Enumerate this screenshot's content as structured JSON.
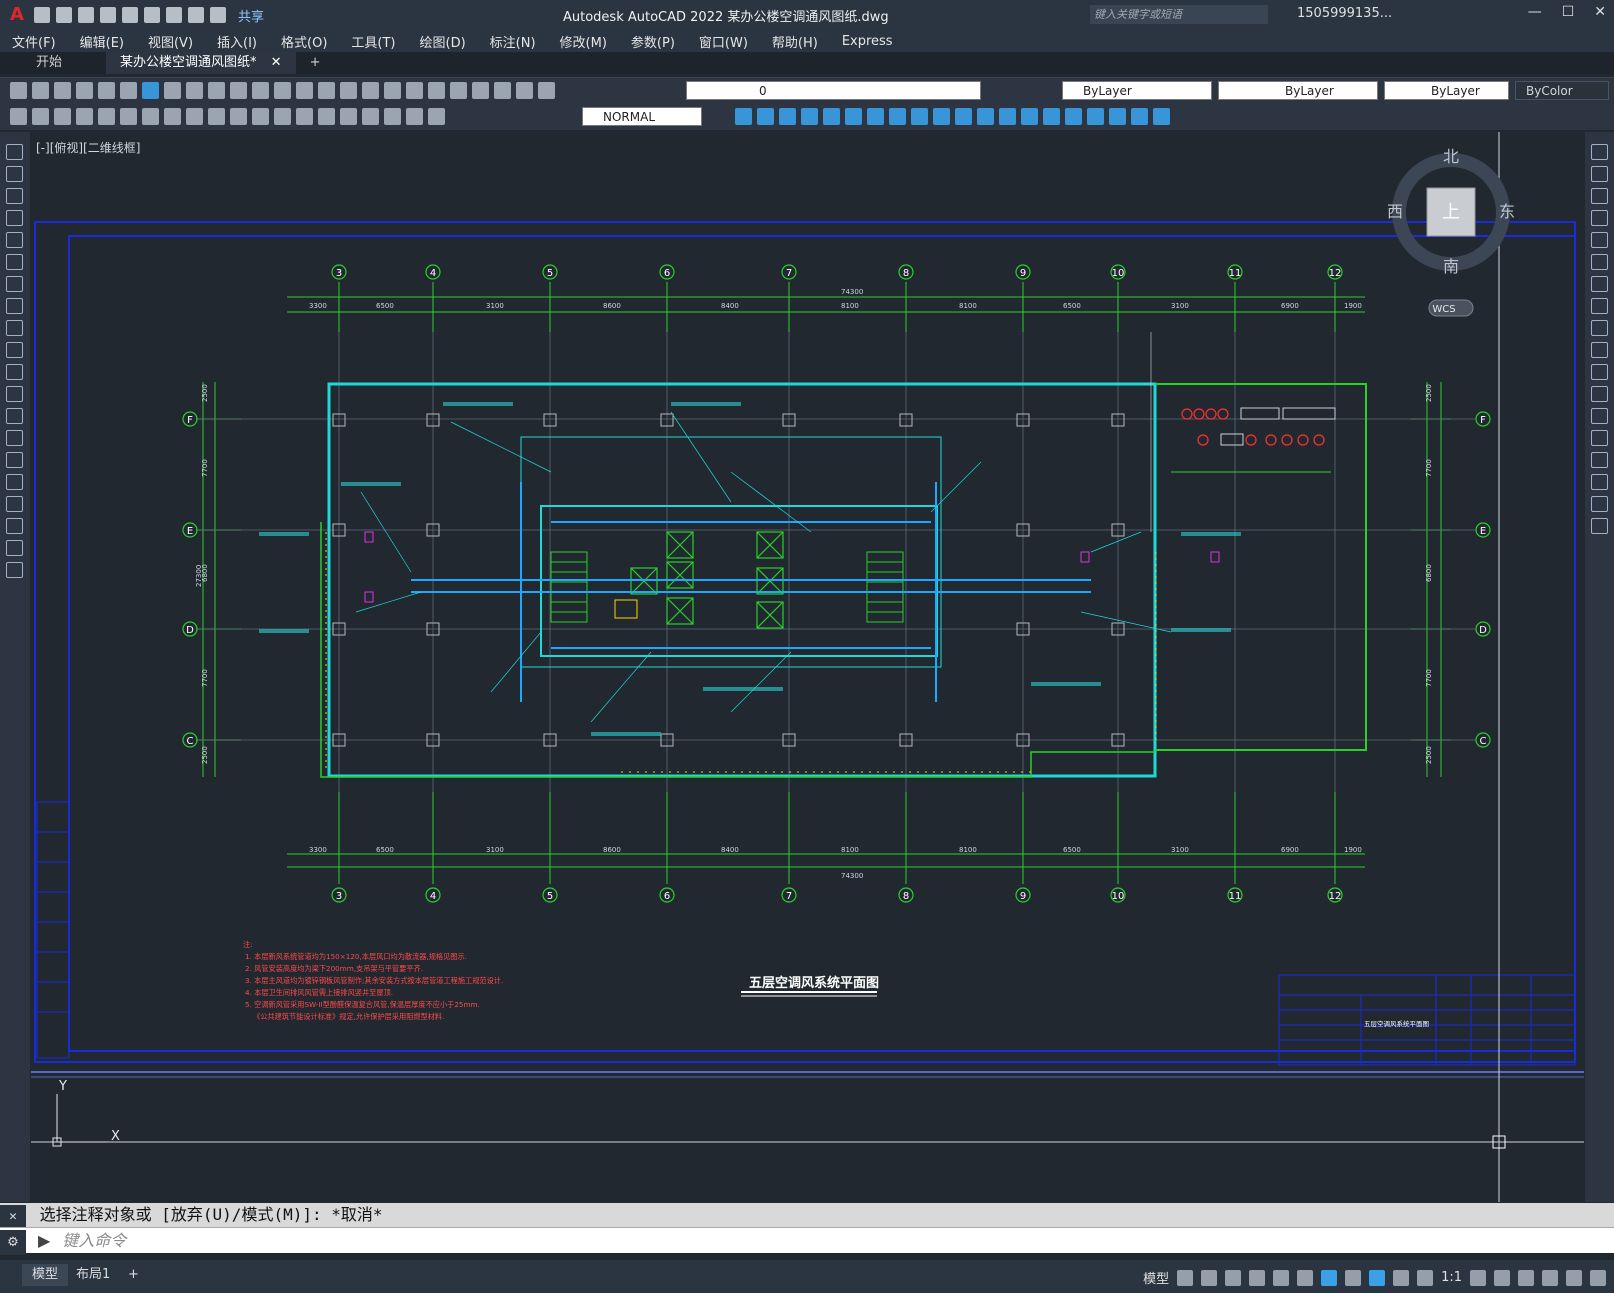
{
  "app": {
    "title": "Autodesk AutoCAD 2022    某办公楼空调通风图纸.dwg",
    "search_placeholder": "键入关键字或短语",
    "user": "1505999135...",
    "share": "共享"
  },
  "menu": [
    "文件(F)",
    "编辑(E)",
    "视图(V)",
    "插入(I)",
    "格式(O)",
    "工具(T)",
    "绘图(D)",
    "标注(N)",
    "修改(M)",
    "参数(P)",
    "窗口(W)",
    "帮助(H)",
    "Express"
  ],
  "doc_tabs": {
    "start": "开始",
    "drawing": "某办公楼空调通风图纸*"
  },
  "toolbar": {
    "layer": "0",
    "color": "ByLayer",
    "linetype": "ByLayer",
    "lineweight": "ByLayer",
    "plotstyle": "ByColor",
    "textstyle": "NORMAL"
  },
  "viewport": {
    "label": "[-][俯视][二维线框]",
    "viewcube": {
      "north": "北",
      "south": "南",
      "east": "东",
      "west": "西",
      "top": "上",
      "wcs": "WCS"
    },
    "ucs": {
      "x": "X",
      "y": "Y"
    }
  },
  "drawing": {
    "title": "五层空调风系统平面图",
    "grid_cols": [
      "3",
      "4",
      "5",
      "6",
      "7",
      "8",
      "9",
      "10",
      "11",
      "12"
    ],
    "grid_rows": [
      "F",
      "E",
      "D",
      "C"
    ],
    "top_dims": [
      "3300",
      "6500",
      "3100",
      "8600",
      "8400",
      "8100",
      "8100",
      "6500",
      "3100",
      "6900",
      "1900"
    ],
    "total_dim": "74300",
    "side_dims": [
      "2500",
      "7700",
      "6800",
      "7700",
      "2500"
    ],
    "side_total": "27300",
    "notes": [
      "注:",
      "1. 本层新风系统管道均为150×120,本层风口均为散流器,规格见图示.",
      "2. 风管安装高度均为梁下200mm,支吊架与平管要平齐.",
      "3. 本层主风道均为镀锌钢板风管制作;其余安装方式按本层管道工程施工规范设计.",
      "4. 本层卫生间排风风管需上接排风竖井至屋顶.",
      "5. 空调新风管采用SW-II型酚醛保温复合风管,保温层厚度不应小于25mm.",
      "《公共建筑节能设计标准》规定,允许保护层采用阻燃型材料."
    ],
    "tb_name": "五层空调风系统平面图"
  },
  "command": {
    "history": "选择注释对象或 [放弃(U)/模式(M)]: *取消*",
    "placeholder": "键入命令"
  },
  "status": {
    "model": "模型",
    "layout": "布局1",
    "add": "+",
    "mode_label": "模型",
    "scale": "1:1"
  }
}
